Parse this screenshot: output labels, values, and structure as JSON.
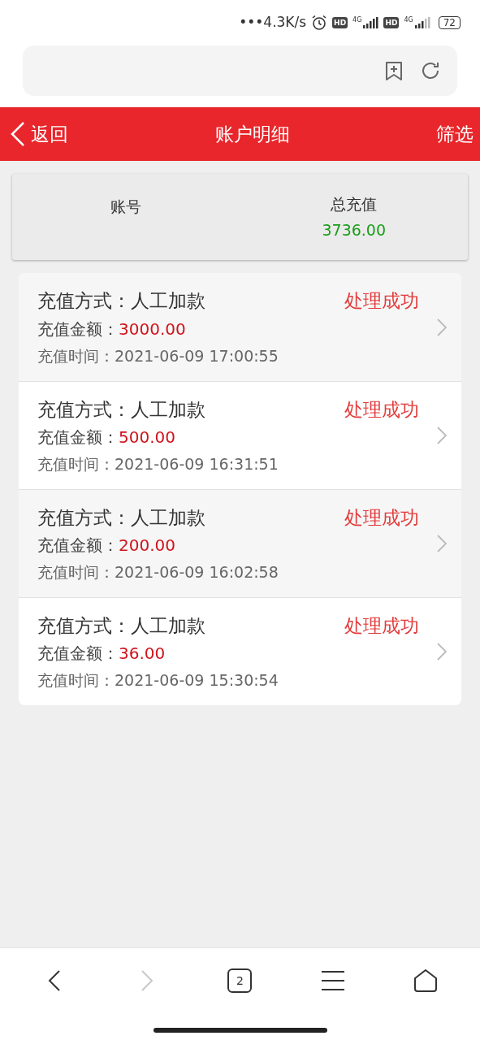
{
  "status_bar": {
    "network_speed": "•••4.3K/s",
    "sim_badges": [
      "HD",
      "HD"
    ],
    "network_types": [
      "4G",
      "4G"
    ],
    "battery": "72"
  },
  "header": {
    "back_label": "返回",
    "title": "账户明细",
    "filter_label": "筛选"
  },
  "summary": {
    "account_label": "账号",
    "total_label": "总充值",
    "total_value": "3736.00"
  },
  "records": [
    {
      "method_label": "充值方式：",
      "method": "人工加款",
      "status": "处理成功",
      "amount_label": "充值金额：",
      "amount": "3000.00",
      "time_label": "充值时间：",
      "time": "2021-06-09 17:00:55"
    },
    {
      "method_label": "充值方式：",
      "method": "人工加款",
      "status": "处理成功",
      "amount_label": "充值金额：",
      "amount": "500.00",
      "time_label": "充值时间：",
      "time": "2021-06-09 16:31:51"
    },
    {
      "method_label": "充值方式：",
      "method": "人工加款",
      "status": "处理成功",
      "amount_label": "充值金额：",
      "amount": "200.00",
      "time_label": "充值时间：",
      "time": "2021-06-09 16:02:58"
    },
    {
      "method_label": "充值方式：",
      "method": "人工加款",
      "status": "处理成功",
      "amount_label": "充值金额：",
      "amount": "36.00",
      "time_label": "充值时间：",
      "time": "2021-06-09 15:30:54"
    }
  ],
  "browser_nav": [
    {
      "kind": "back",
      "disabled": false
    },
    {
      "kind": "forward",
      "disabled": true
    },
    {
      "kind": "tabs",
      "count": "2",
      "disabled": false
    },
    {
      "kind": "menu",
      "disabled": false
    },
    {
      "kind": "home",
      "disabled": false
    }
  ]
}
